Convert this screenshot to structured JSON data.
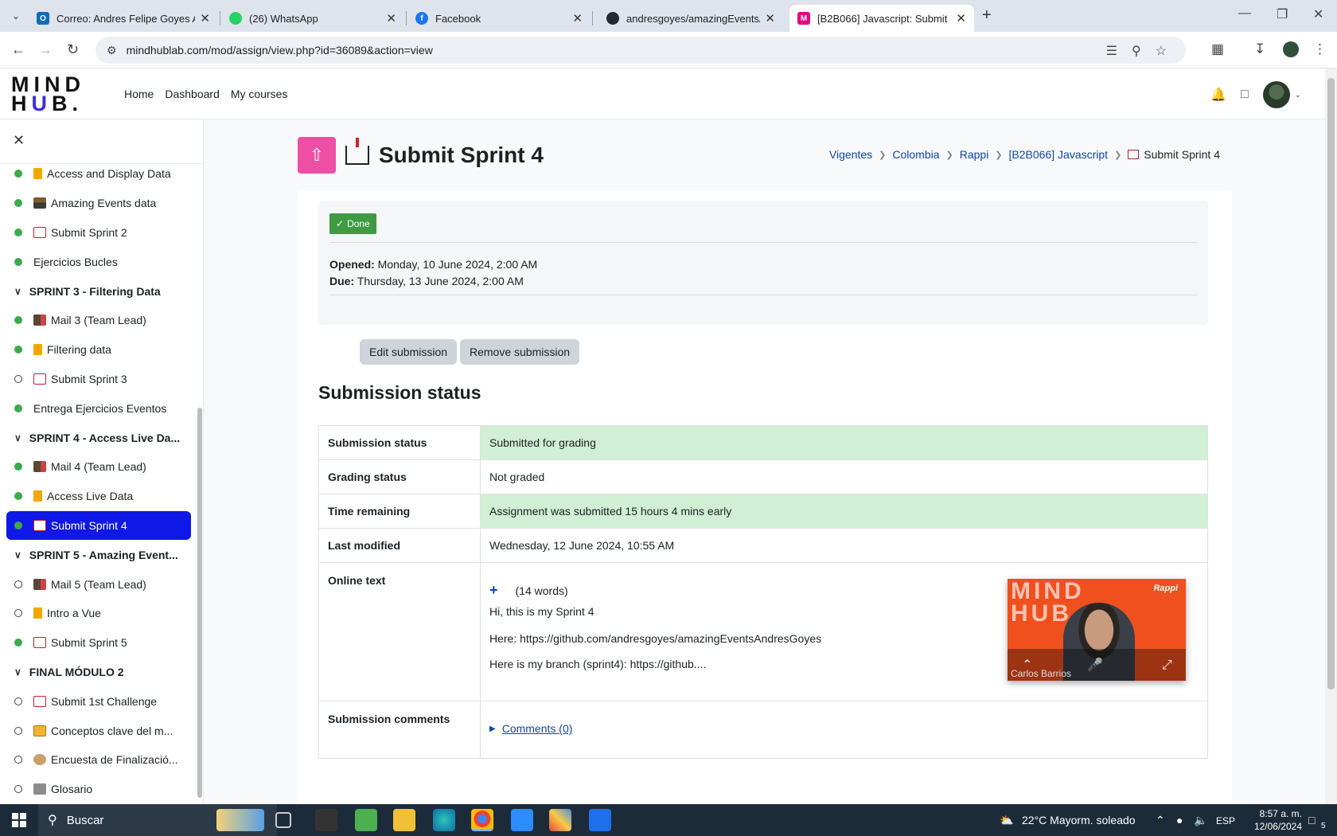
{
  "browser": {
    "tabs": [
      {
        "title": "Correo: Andres Felipe Goyes Ap",
        "icon": "outlook-icon",
        "color": "#0f6cbd"
      },
      {
        "title": "(26) WhatsApp",
        "icon": "whatsapp-icon",
        "color": "#25d366"
      },
      {
        "title": "Facebook",
        "icon": "facebook-icon",
        "color": "#1877f2"
      },
      {
        "title": "andresgoyes/amazingEventsAn",
        "icon": "github-icon",
        "color": "#24292f"
      },
      {
        "title": "[B2B066] Javascript: Submit",
        "icon": "moodle-icon",
        "color": "#e6007e"
      }
    ],
    "url": "mindhublab.com/mod/assign/view.php?id=36089&action=view"
  },
  "navbar": {
    "logo_line1": "MIND",
    "logo_line2_a": "H",
    "logo_line2_u": "U",
    "logo_line2_b": "B.",
    "links": [
      "Home",
      "Dashboard",
      "My courses"
    ]
  },
  "sidebar": {
    "items": [
      {
        "type": "item",
        "label": "Access and Display Data",
        "state": "done",
        "icon": "book-icon"
      },
      {
        "type": "item",
        "label": "Amazing Events data",
        "state": "done",
        "icon": "data-icon"
      },
      {
        "type": "item",
        "label": "Submit Sprint 2",
        "state": "done",
        "icon": "submit-icon"
      },
      {
        "type": "item",
        "label": "Ejercicios Bucles",
        "state": "done",
        "icon": ""
      },
      {
        "type": "section",
        "label": "SPRINT 3 - Filtering Data"
      },
      {
        "type": "item",
        "label": "Mail 3 (Team Lead)",
        "state": "done",
        "icon": "mail-icon"
      },
      {
        "type": "item",
        "label": "Filtering data",
        "state": "done",
        "icon": "book-icon"
      },
      {
        "type": "item",
        "label": "Submit Sprint 3",
        "state": "todo",
        "icon": "submit-icon"
      },
      {
        "type": "item",
        "label": "Entrega Ejercicios Eventos",
        "state": "done",
        "icon": ""
      },
      {
        "type": "section",
        "label": "SPRINT 4 - Access Live Da..."
      },
      {
        "type": "item",
        "label": "Mail 4 (Team Lead)",
        "state": "done",
        "icon": "mail-icon"
      },
      {
        "type": "item",
        "label": "Access Live Data",
        "state": "done",
        "icon": "book-icon"
      },
      {
        "type": "item",
        "label": "Submit Sprint 4",
        "state": "done",
        "icon": "submit-icon",
        "active": true
      },
      {
        "type": "section",
        "label": "SPRINT 5 - Amazing Event..."
      },
      {
        "type": "item",
        "label": "Mail 5 (Team Lead)",
        "state": "todo",
        "icon": "mail-icon"
      },
      {
        "type": "item",
        "label": "Intro a Vue",
        "state": "todo",
        "icon": "book-icon"
      },
      {
        "type": "item",
        "label": "Submit Sprint 5",
        "state": "done",
        "icon": "submit-icon"
      },
      {
        "type": "section",
        "label": "FINAL MÓDULO 2"
      },
      {
        "type": "item",
        "label": "Submit 1st Challenge",
        "state": "todo",
        "icon": "submit-icon"
      },
      {
        "type": "item",
        "label": "Conceptos clave del m...",
        "state": "todo",
        "icon": "quiz-icon"
      },
      {
        "type": "item",
        "label": "Encuesta de Finalizació...",
        "state": "todo",
        "icon": "survey-icon"
      },
      {
        "type": "item",
        "label": "Glosario",
        "state": "todo",
        "icon": "glossary-icon"
      }
    ]
  },
  "page": {
    "title": "Submit Sprint 4",
    "breadcrumb": [
      "Vigentes",
      "Colombia",
      "Rappi",
      "[B2B066] Javascript"
    ],
    "breadcrumb_current": "Submit Sprint 4",
    "done_label": "Done",
    "opened_label": "Opened:",
    "opened_value": "Monday, 10 June 2024, 2:00 AM",
    "due_label": "Due:",
    "due_value": "Thursday, 13 June 2024, 2:00 AM",
    "edit_button": "Edit submission",
    "remove_button": "Remove submission",
    "section_title": "Submission status"
  },
  "status": {
    "submission_status_k": "Submission status",
    "submission_status_v": "Submitted for grading",
    "grading_status_k": "Grading status",
    "grading_status_v": "Not graded",
    "time_remaining_k": "Time remaining",
    "time_remaining_v": "Assignment was submitted 15 hours 4 mins early",
    "last_modified_k": "Last modified",
    "last_modified_v": "Wednesday, 12 June 2024, 10:55 AM",
    "online_text_k": "Online text",
    "online_text_plus": "+",
    "online_text_words": "(14 words)",
    "online_text_line1": "Hi, this is my Sprint 4",
    "online_text_line2": "Here: https://github.com/andresgoyes/amazingEventsAndresGoyes",
    "online_text_line3": "Here is my branch (sprint4): https://github....",
    "comments_k": "Submission comments",
    "comments_link": "Comments (0)"
  },
  "video": {
    "logo1": "MIND",
    "logo2": "HUB",
    "brand": "Rappi",
    "participant": "Carlos Barrios"
  },
  "taskbar": {
    "search": "Buscar",
    "weather": "22°C  Mayorm. soleado",
    "lang": "ESP",
    "time": "8:57 a. m.",
    "date": "12/06/2024",
    "notif_count": "5"
  }
}
